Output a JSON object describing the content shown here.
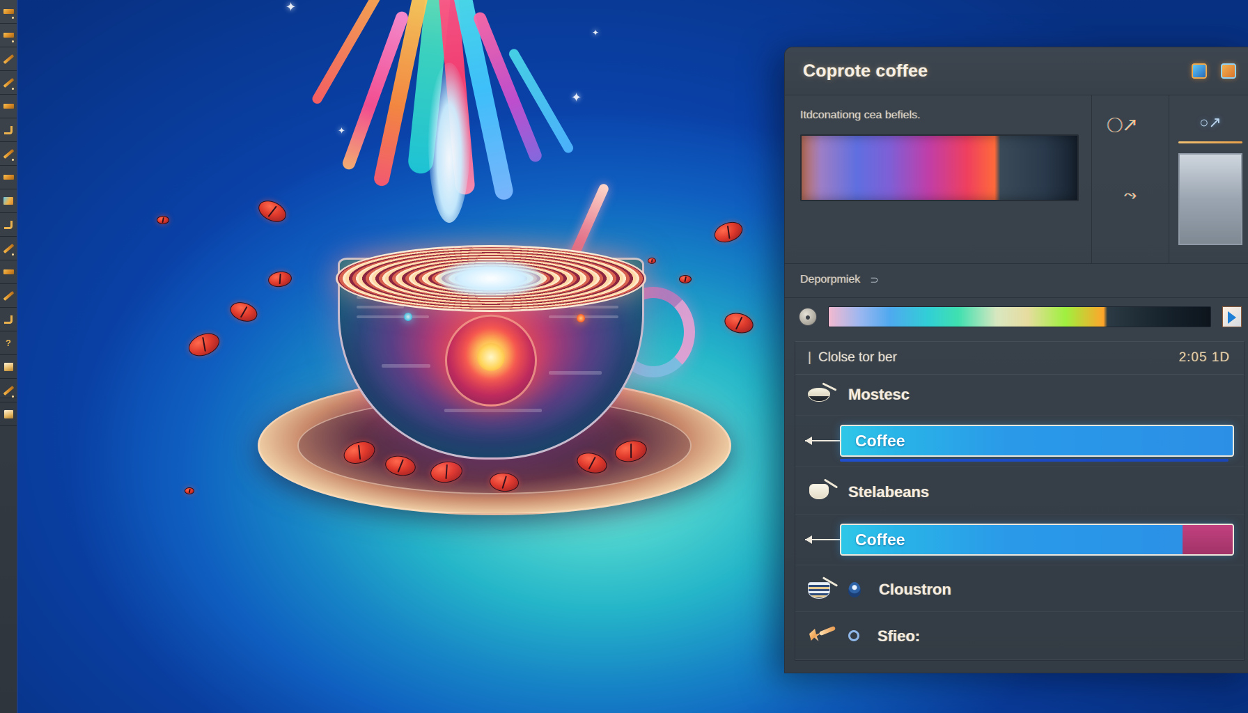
{
  "window": {
    "title": "Coprote coffee",
    "titlebar_icons": [
      "panel-toggle-icon",
      "expand-icon"
    ]
  },
  "inspector": {
    "caption": "Itdconationg cea befiels.",
    "gradient_preview_name": "color-gradient-preview",
    "side_glyphs": [
      "magnifier-glyph",
      "brush-glyph"
    ],
    "far_glyphs": [
      "loupe-glyph"
    ],
    "depth": {
      "label": "Deporpmiek",
      "value": "⊃"
    }
  },
  "spectrum": {
    "knob_name": "spectrum-knob",
    "strip_name": "spectrum-strip",
    "play_name": "play-button"
  },
  "list": {
    "header": {
      "title": "Clolse tor ber",
      "meta": "2:05 1D"
    },
    "rows": [
      {
        "type": "item",
        "icon": "spoon-bowl-icon",
        "label": "Mostesc"
      },
      {
        "type": "bar",
        "label": "Coffee",
        "segment": false,
        "underline": true
      },
      {
        "type": "item",
        "icon": "cup-icon",
        "label": "Stelabeans"
      },
      {
        "type": "bar",
        "label": "Coffee",
        "segment": true,
        "underline": false
      },
      {
        "type": "item",
        "icon": "bowl-icon",
        "label": "Cloustron",
        "marker": "pin"
      },
      {
        "type": "item",
        "icon": "bird-icon",
        "label": "Sfieo:",
        "marker": "dot"
      }
    ]
  },
  "toolbar": {
    "tools": [
      "brush-tool",
      "fill-tool",
      "line-tool",
      "pencil-tool",
      "stamp-tool",
      "eraser-tool",
      "pen-tool",
      "bucket-tool",
      "image-tool",
      "shape-tool",
      "slice-tool",
      "path-tool",
      "crop-tool",
      "help-tool",
      "gradient-tool",
      "dodge-tool",
      "rect-tool"
    ]
  },
  "colors": {
    "panel_bg": "#374049",
    "accent_blue": "#2b8fe6",
    "accent_magenta": "#c2407f",
    "text": "#f4ede0",
    "canvas_teal": "#25b6c9",
    "canvas_blue": "#0e63c4"
  }
}
